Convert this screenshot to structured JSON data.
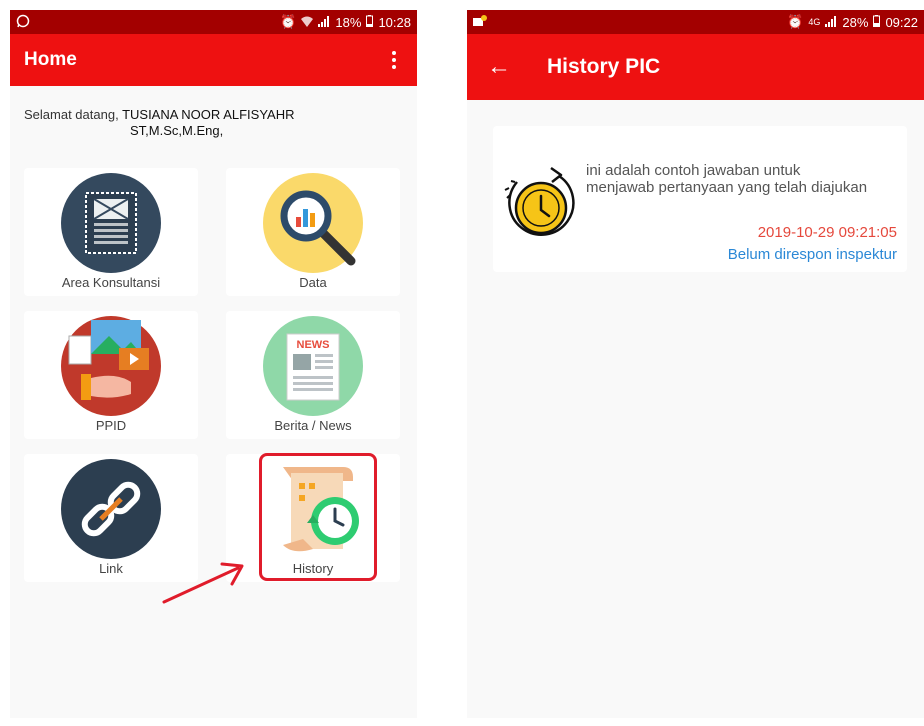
{
  "left_screen": {
    "status": {
      "time": "10:28",
      "battery": "18%"
    },
    "appbar": {
      "title": "Home"
    },
    "welcome": {
      "prefix": "Selamat datang, ",
      "name_line1": "TUSIANA NOOR ALFISYAHR",
      "name_line2": "ST,M.Sc,M.Eng,"
    },
    "menu": [
      {
        "label": "Area Konsultansi",
        "icon": "blueprint-icon"
      },
      {
        "label": "Data",
        "icon": "magnifier-chart-icon"
      },
      {
        "label": "PPID",
        "icon": "media-hand-icon"
      },
      {
        "label": "Berita / News",
        "icon": "newspaper-icon"
      },
      {
        "label": "Link",
        "icon": "chain-link-icon"
      },
      {
        "label": "History",
        "icon": "history-scroll-icon"
      }
    ],
    "news_badge": "NEWS"
  },
  "right_screen": {
    "status": {
      "time": "09:22",
      "battery": "28%",
      "network": "4G"
    },
    "appbar": {
      "title": "History PIC"
    },
    "history": [
      {
        "message_line1": "ini adalah contoh jawaban untuk",
        "message_line2": "menjawab pertanyaan yang telah diajukan",
        "date": "2019-10-29 09:21:05",
        "status": "Belum direspon inspektur"
      }
    ]
  },
  "colors": {
    "status_bar": "#a30000",
    "app_bar": "#ee1111",
    "date": "#e5483c",
    "status_text": "#2b88d6",
    "highlight": "#e01c2b"
  }
}
